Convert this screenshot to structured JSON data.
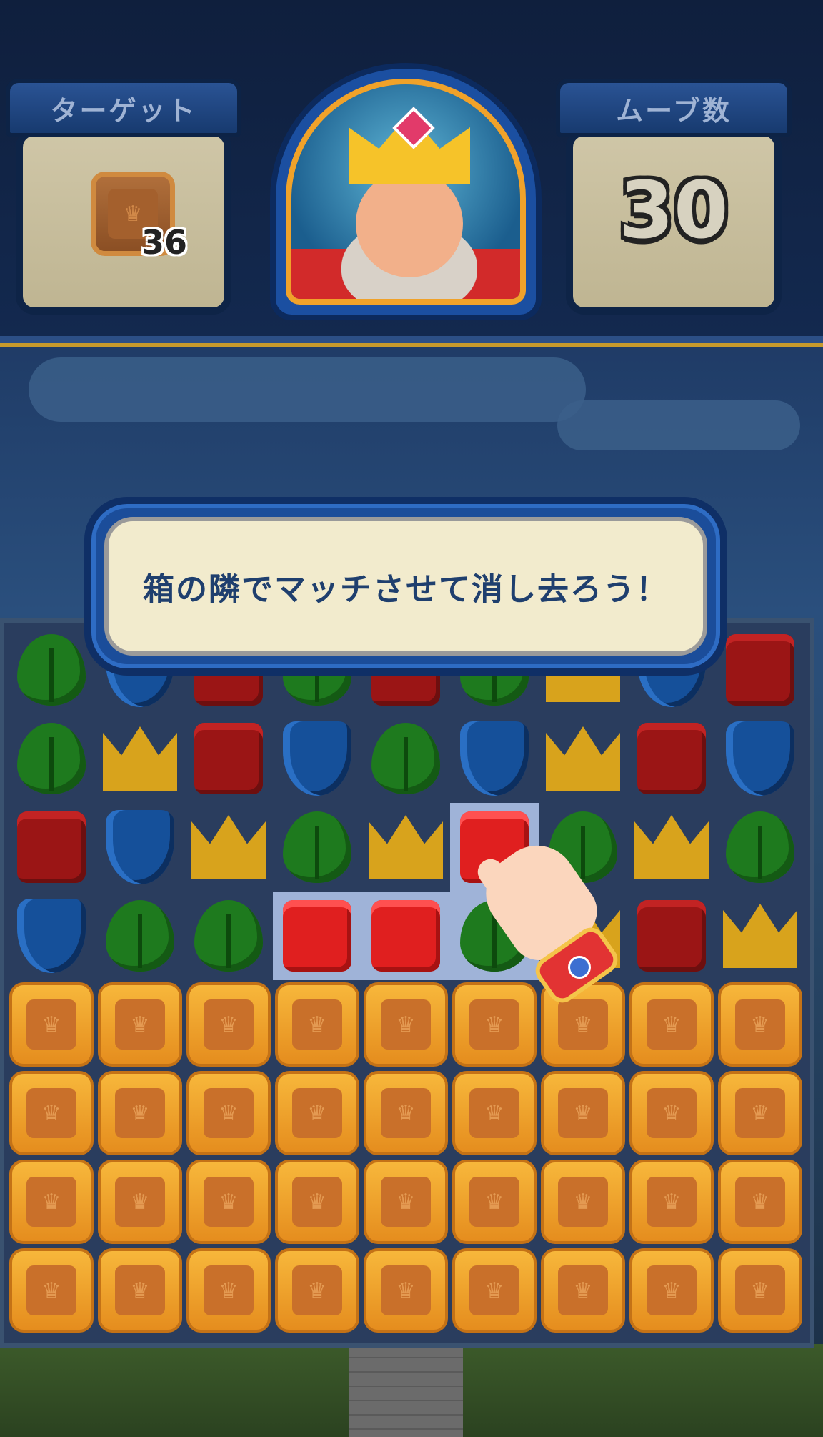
{
  "hud": {
    "target_label": "ターゲット",
    "target_count": "36",
    "moves_label": "ムーブ数",
    "moves_count": "30"
  },
  "tip": {
    "text": "箱の隣でマッチさせて消し去ろう！"
  },
  "board": {
    "rows": [
      [
        "leaf",
        "shield",
        "box",
        "leaf",
        "box",
        "leaf",
        "crown",
        "shield",
        "box"
      ],
      [
        "leaf",
        "crown",
        "box",
        "shield",
        "leaf",
        "shield",
        "crown",
        "box",
        "shield"
      ],
      [
        "box",
        "shield",
        "crown",
        "leaf",
        "crown",
        "box-bright",
        "leaf",
        "crown",
        "leaf"
      ],
      [
        "shield",
        "leaf",
        "leaf",
        "box-bright",
        "box-bright",
        "leaf",
        "crown",
        "box",
        "crown"
      ],
      [
        "crate",
        "crate",
        "crate",
        "crate",
        "crate",
        "crate",
        "crate",
        "crate",
        "crate"
      ],
      [
        "crate",
        "crate",
        "crate",
        "crate",
        "crate",
        "crate",
        "crate",
        "crate",
        "crate"
      ],
      [
        "crate",
        "crate",
        "crate",
        "crate",
        "crate",
        "crate",
        "crate",
        "crate",
        "crate"
      ],
      [
        "crate",
        "crate",
        "crate",
        "crate",
        "crate",
        "crate",
        "crate",
        "crate",
        "crate"
      ]
    ],
    "highlighted": [
      [
        2,
        5
      ],
      [
        3,
        3
      ],
      [
        3,
        4
      ],
      [
        3,
        5
      ]
    ]
  },
  "icons": {
    "crate_symbol": "♛",
    "tutorial_hand": "pointing-hand-icon"
  },
  "colors": {
    "hud_bg": "#0f1f3d",
    "tip_text": "#1f3f6e",
    "crate": "#f7b73b"
  }
}
